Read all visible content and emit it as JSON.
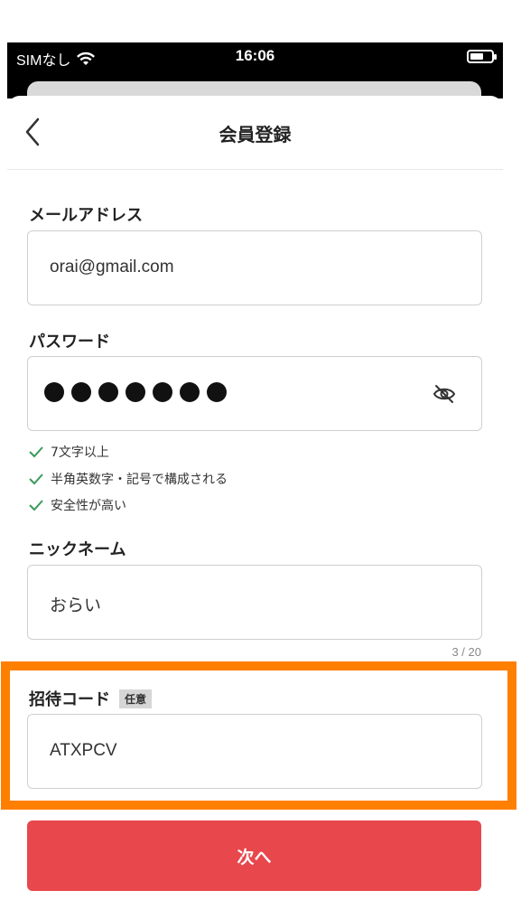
{
  "status_bar": {
    "carrier": "SIMなし",
    "time": "16:06"
  },
  "nav": {
    "title": "会員登録"
  },
  "form": {
    "email": {
      "label": "メールアドレス",
      "value": "orai@gmail.com"
    },
    "password": {
      "label": "パスワード",
      "masked_length": 7,
      "rules": [
        "7文字以上",
        "半角英数字・記号で構成される",
        "安全性が高い"
      ]
    },
    "nickname": {
      "label": "ニックネーム",
      "value": "おらい",
      "counter": "3 / 20"
    },
    "invite_code": {
      "label": "招待コード",
      "badge": "任意",
      "value": "ATXPCV"
    }
  },
  "next_button": {
    "label": "次へ"
  },
  "colors": {
    "accent": "#e8474c",
    "check": "#3a9a5b",
    "highlight": "#ff7f00"
  }
}
